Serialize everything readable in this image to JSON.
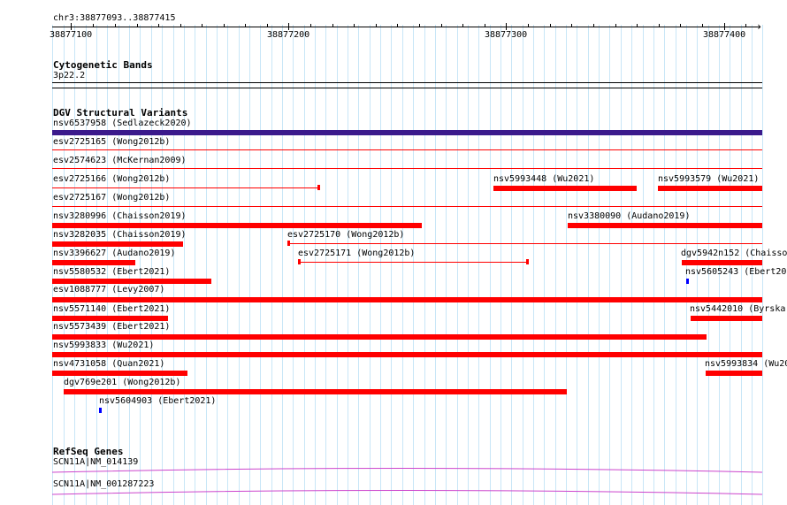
{
  "header": {
    "location": "chr3:38877093..38877415"
  },
  "ruler": {
    "ticks": [
      {
        "label": "38877100"
      },
      {
        "label": "38877200"
      },
      {
        "label": "38877300"
      },
      {
        "label": "38877400"
      }
    ]
  },
  "cytobands": {
    "title": "Cytogenetic Bands",
    "band": "3p22.2"
  },
  "dgv": {
    "title": "DGV Structural Variants",
    "features": [
      {
        "label": "nsv6537958 (Sedlazeck2020)",
        "color": "#3b1a8c"
      },
      {
        "label": "esv2725165 (Wong2012b)",
        "color": "#ff0000"
      },
      {
        "label": "esv2574623 (McKernan2009)",
        "color": "#ff0000"
      },
      {
        "label": "esv2725166 (Wong2012b)",
        "color": "#ff0000"
      },
      {
        "label": "nsv5993448 (Wu2021)",
        "color": "#ff0000"
      },
      {
        "label": "nsv5993579 (Wu2021)",
        "color": "#ff0000"
      },
      {
        "label": "esv2725167 (Wong2012b)",
        "color": "#ff0000"
      },
      {
        "label": "nsv3280996 (Chaisson2019)",
        "color": "#ff0000"
      },
      {
        "label": "nsv3380090 (Audano2019)",
        "color": "#ff0000"
      },
      {
        "label": "nsv3282035 (Chaisson2019)",
        "color": "#ff0000"
      },
      {
        "label": "esv2725170 (Wong2012b)",
        "color": "#ff0000"
      },
      {
        "label": "nsv3396627 (Audano2019)",
        "color": "#ff0000"
      },
      {
        "label": "esv2725171 (Wong2012b)",
        "color": "#ff0000"
      },
      {
        "label": "dgv5942n152 (Chaisso",
        "color": "#ff0000"
      },
      {
        "label": "nsv5580532 (Ebert2021)",
        "color": "#ff0000"
      },
      {
        "label": "nsv5605243 (Ebert20",
        "color": "#0000ff"
      },
      {
        "label": "esv1088777 (Levy2007)",
        "color": "#ff0000"
      },
      {
        "label": "nsv5571140 (Ebert2021)",
        "color": "#ff0000"
      },
      {
        "label": "nsv5442010 (Byrska",
        "color": "#ff0000"
      },
      {
        "label": "nsv5573439 (Ebert2021)",
        "color": "#ff0000"
      },
      {
        "label": "nsv5993833 (Wu2021)",
        "color": "#ff0000"
      },
      {
        "label": "nsv4731058 (Quan2021)",
        "color": "#ff0000"
      },
      {
        "label": "nsv5993834 (Wu20",
        "color": "#ff0000"
      },
      {
        "label": "dgv769e201 (Wong2012b)",
        "color": "#ff0000"
      },
      {
        "label": "nsv5604903 (Ebert2021)",
        "color": "#0000ff"
      }
    ]
  },
  "refseq": {
    "title": "RefSeq Genes",
    "genes": [
      {
        "label": "SCN11A|NM_014139",
        "color": "#cc44cc"
      },
      {
        "label": "SCN11A|NM_001287223",
        "color": "#cc44cc"
      }
    ]
  }
}
